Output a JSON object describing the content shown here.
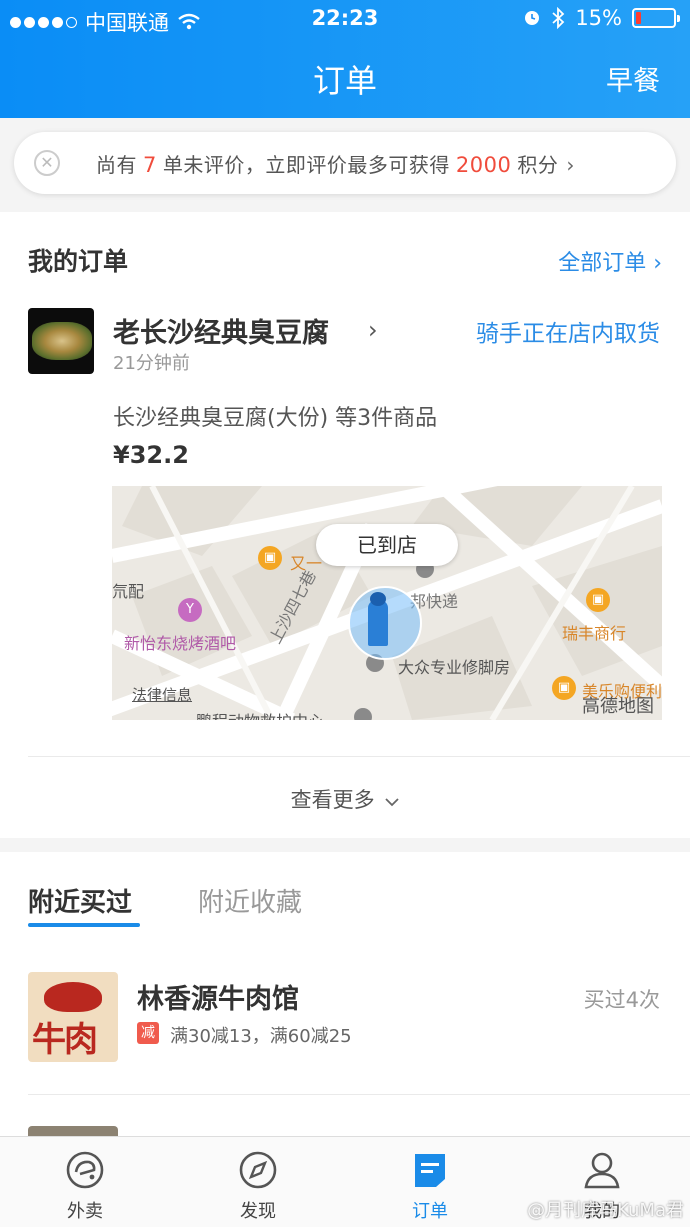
{
  "status_bar": {
    "carrier": "中国联通",
    "time": "22:23",
    "battery": "15%",
    "battery_level": 0.15
  },
  "nav": {
    "title": "订单",
    "right_label": "早餐"
  },
  "notice": {
    "prefix": "尚有",
    "count": "7",
    "middle": "单未评价，立即评价最多可获得",
    "points": "2000",
    "suffix": "积分",
    "arrow": "›"
  },
  "orders": {
    "title": "我的订单",
    "all_link": "全部订单 ›",
    "shop_name": "老长沙经典臭豆腐",
    "chevron": "›",
    "status": "骑手正在店内取货",
    "time": "21分钟前",
    "items": "长沙经典臭豆腐(大份) 等3件商品",
    "price": "¥32.2",
    "map": {
      "bubble": "已到店",
      "labels": {
        "shop1": "又一",
        "express": "邦快递",
        "bar": "新怡东烧烤酒吧",
        "street": "上沙四七巷",
        "repair": "大众专业修脚房",
        "ruifeng": "瑞丰商行",
        "meile": "美乐购便利",
        "left_edge": "氘配",
        "bottom": "鹏程动物救护中心"
      },
      "legal": "法律信息",
      "brand": "高德地图"
    },
    "see_more": "查看更多"
  },
  "nearby": {
    "tabs": [
      "附近买过",
      "附近收藏"
    ],
    "shop": {
      "name": "林香源牛肉馆",
      "bought": "买过4次",
      "badge": "减",
      "promo": "满30减13，满60减25",
      "logo_text": "牛肉"
    }
  },
  "tabbar": [
    {
      "label": "外卖",
      "icon": "takeout-icon"
    },
    {
      "label": "发现",
      "icon": "compass-icon"
    },
    {
      "label": "订单",
      "icon": "order-icon"
    },
    {
      "label": "我的",
      "icon": "profile-icon"
    }
  ],
  "watermark": "@月刊库马KuMa君",
  "colors": {
    "accent": "#1a8be8",
    "header": "#0a8df6",
    "highlight": "#f04c3c",
    "badge": "#f05b4d"
  }
}
